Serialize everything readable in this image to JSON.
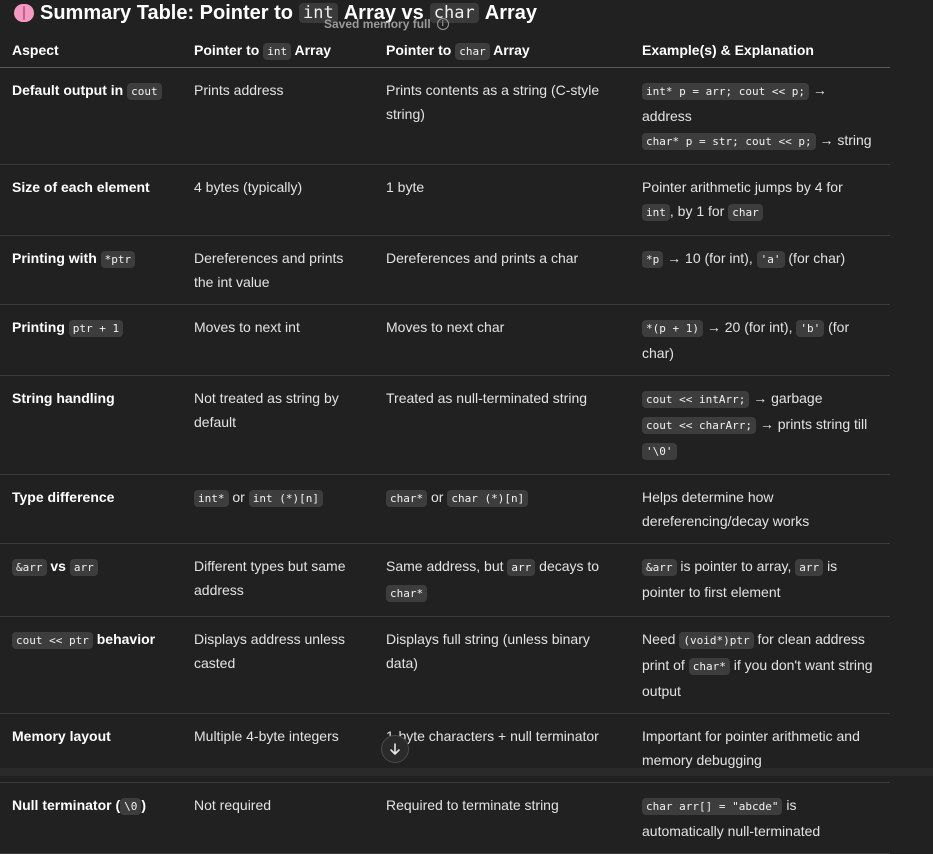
{
  "heading": {
    "emoji_icon": "brain-icon",
    "pre": "Summary Table: Pointer to",
    "code1": "int",
    "mid": "Array vs",
    "code2": "char",
    "post": "Array"
  },
  "toast": {
    "text": "Saved memory full",
    "icon": "info-icon"
  },
  "table": {
    "headers": {
      "aspect": "Aspect",
      "int_pre": "Pointer to",
      "int_code": "int",
      "int_post": "Array",
      "char_pre": "Pointer to",
      "char_code": "char",
      "char_post": "Array",
      "example": "Example(s) & Explanation"
    },
    "rows": [
      {
        "aspect_pre": "Default output in",
        "aspect_code": "cout",
        "int": "Prints address",
        "char": "Prints contents as a string (C-style string)",
        "ex_l1_code": "int* p = arr; cout << p;",
        "ex_l1_text": "→ address",
        "ex_l2_code": "char* p = str; cout << p;",
        "ex_l2_text": "→ string"
      },
      {
        "aspect": "Size of each element",
        "int": "4 bytes (typically)",
        "char": "1 byte",
        "ex_t1": "Pointer arithmetic jumps by 4 for",
        "ex_c1": "int",
        "ex_t2": ", by 1 for",
        "ex_c2": "char"
      },
      {
        "aspect_pre": "Printing with",
        "aspect_code": "*ptr",
        "int": "Dereferences and prints the int value",
        "char": "Dereferences and prints a char",
        "ex_c1": "*p",
        "ex_t1": "→ 10 (for int),",
        "ex_c2": "'a'",
        "ex_t2": "(for char)"
      },
      {
        "aspect_pre": "Printing",
        "aspect_code": "ptr + 1",
        "int": "Moves to next int",
        "char": "Moves to next char",
        "ex_c1": "*(p + 1)",
        "ex_t1": "→ 20 (for int),",
        "ex_c2": "'b'",
        "ex_t2": "(for char)"
      },
      {
        "aspect": "String handling",
        "int": "Not treated as string by default",
        "char": "Treated as null-terminated string",
        "ex_l1_code": "cout << intArr;",
        "ex_l1_text": "→ garbage",
        "ex_l2_code": "cout << charArr;",
        "ex_l2_text": "→ prints string till",
        "ex_l3_code": "'\\0'"
      },
      {
        "aspect": "Type difference",
        "int_c1": "int*",
        "int_or": "or",
        "int_c2": "int (*)[n]",
        "char_c1": "char*",
        "char_or": "or",
        "char_c2": "char (*)[n]",
        "ex": "Helps determine how dereferencing/decay works"
      },
      {
        "aspect_c1": "&arr",
        "aspect_vs": "vs",
        "aspect_c2": "arr",
        "int": "Different types but same address",
        "char_t1": "Same address, but",
        "char_c1": "arr",
        "char_t2": "decays to",
        "char_c2": "char*",
        "ex_c1": "&arr",
        "ex_t1": "is pointer to array,",
        "ex_c2": "arr",
        "ex_t2": "is pointer to first element"
      },
      {
        "aspect_code": "cout << ptr",
        "aspect_post": "behavior",
        "int": "Displays address unless casted",
        "char": "Displays full string (unless binary data)",
        "ex_t1": "Need",
        "ex_c1": "(void*)ptr",
        "ex_t2": "for clean address print of",
        "ex_c2": "char*",
        "ex_t3": "if you don't want string output"
      },
      {
        "aspect": "Memory layout",
        "int": "Multiple 4-byte integers",
        "char": "1-byte characters + null terminator",
        "ex": "Important for pointer arithmetic and memory debugging"
      },
      {
        "aspect_pre": "Null terminator (",
        "aspect_code": "\\0",
        "aspect_post": ")",
        "int": "Not required",
        "char": "Required to terminate string",
        "ex_code": "char arr[] = \"abcde\"",
        "ex_text": "is automatically null-terminated"
      }
    ]
  },
  "scroll_button": {
    "icon": "arrow-down-icon"
  }
}
